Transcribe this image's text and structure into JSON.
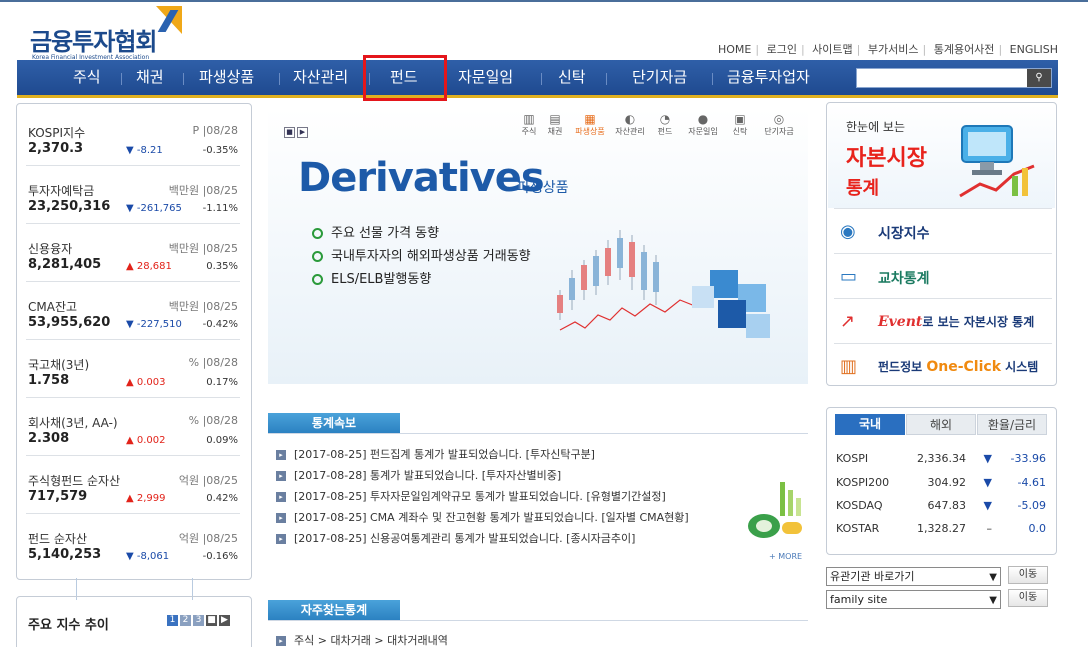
{
  "logo": {
    "ko": "금융투자협회",
    "en": "Korea Financial Investment Association"
  },
  "util_links": [
    "HOME",
    "로그인",
    "사이트맵",
    "부가서비스",
    "통계용어사전",
    "ENGLISH"
  ],
  "gnb": [
    "주식",
    "채권",
    "파생상품",
    "자산관리",
    "펀드",
    "자문일임",
    "신탁",
    "단기자금",
    "금융투자업자"
  ],
  "gnb_highlight": "펀드",
  "indices": [
    {
      "name": "KOSPI지수",
      "unit": "P |08/28",
      "value": "2,370.3",
      "change": "-8.21",
      "dir": "dn",
      "pct": "-0.35%"
    },
    {
      "name": "투자자예탁금",
      "unit": "백만원 |08/25",
      "value": "23,250,316",
      "change": "-261,765",
      "dir": "dn",
      "pct": "-1.11%"
    },
    {
      "name": "신용융자",
      "unit": "백만원 |08/25",
      "value": "8,281,405",
      "change": "28,681",
      "dir": "up",
      "pct": "0.35%"
    },
    {
      "name": "CMA잔고",
      "unit": "백만원 |08/25",
      "value": "53,955,620",
      "change": "-227,510",
      "dir": "dn",
      "pct": "-0.42%"
    },
    {
      "name": "국고채(3년)",
      "unit": "% |08/28",
      "value": "1.758",
      "change": "0.003",
      "dir": "up",
      "pct": "0.17%"
    },
    {
      "name": "회사채(3년, AA-)",
      "unit": "% |08/28",
      "value": "2.308",
      "change": "0.002",
      "dir": "up",
      "pct": "0.09%"
    },
    {
      "name": "주식형펀드 순자산",
      "unit": "억원 |08/25",
      "value": "717,579",
      "change": "2,999",
      "dir": "up",
      "pct": "0.42%"
    },
    {
      "name": "펀드 순자산",
      "unit": "억원 |08/25",
      "value": "5,140,253",
      "change": "-8,061",
      "dir": "dn",
      "pct": "-0.16%"
    }
  ],
  "trend": {
    "title": "주요 지수 추이",
    "pages": [
      "1",
      "2",
      "3"
    ]
  },
  "banner": {
    "icons": [
      {
        "label": "주식",
        "glyph": "▥"
      },
      {
        "label": "채권",
        "glyph": "▤"
      },
      {
        "label": "파생상품",
        "glyph": "▦"
      },
      {
        "label": "자산관리",
        "glyph": "◐"
      },
      {
        "label": "펀드",
        "glyph": "◔"
      },
      {
        "label": "자문일임",
        "glyph": "●"
      },
      {
        "label": "신탁",
        "glyph": "▣"
      },
      {
        "label": "단기자금",
        "glyph": "◎"
      }
    ],
    "active": "파생상품",
    "title": "Derivatives",
    "subtitle": "파생상품",
    "items": [
      "주요 선물 가격 동향",
      "국내투자자의 해외파생상품 거래동향",
      "ELS/ELB발행동향"
    ]
  },
  "stats_news": {
    "heading": "통계속보",
    "items": [
      "[2017-08-25] 펀드집계 통계가 발표되었습니다. [투자신탁구분]",
      "[2017-08-28] 통계가 발표되었습니다. [투자자산별비중]",
      "[2017-08-25] 투자자문일임계약규모 통계가 발표되었습니다. [유형별기간설정]",
      "[2017-08-25] CMA 계좌수 및 잔고현황 통계가 발표되었습니다. [일자별 CMA현황]",
      "[2017-08-25] 신용공여통계관리 통계가 발표되었습니다. [종시자금추이]"
    ],
    "more": "+ MORE"
  },
  "freq": {
    "heading": "자주찾는통계",
    "items": [
      "주식 > 대차거래 > 대차거래내역"
    ]
  },
  "right_promo": {
    "pre": "한눈에 보는",
    "big": "자본시장",
    "big2": "통계",
    "rows": [
      {
        "icon": "globe-icon",
        "glyph": "◉",
        "parts": [
          "시장지수"
        ]
      },
      {
        "icon": "monitor-icon",
        "glyph": "▭",
        "parts": [
          "교차통계"
        ]
      },
      {
        "icon": "chart-icon",
        "glyph": "↗",
        "parts": [
          "Event",
          "로 보는 자본시장 통계"
        ]
      },
      {
        "icon": "bar-icon",
        "glyph": "▥",
        "parts": [
          "펀드정보 ",
          "One-Click",
          " 시스템"
        ]
      }
    ]
  },
  "market": {
    "tabs": [
      "국내",
      "해외",
      "환율/금리"
    ],
    "rows": [
      {
        "name": "KOSPI",
        "value": "2,336.34",
        "change": "-33.96"
      },
      {
        "name": "KOSPI200",
        "value": "304.92",
        "change": "-4.61"
      },
      {
        "name": "KOSDAQ",
        "value": "647.83",
        "change": "-5.09"
      },
      {
        "name": "KOSTAR",
        "value": "1,328.27",
        "change": "0.0"
      }
    ]
  },
  "selects": [
    {
      "value": "유관기관 바로가기",
      "button": "이동"
    },
    {
      "value": "family site",
      "button": "이동"
    }
  ],
  "colors": {
    "brand": "#1f4a90",
    "up": "#e2231a",
    "down": "#1a4aa8",
    "highlight": "#e4161b"
  }
}
